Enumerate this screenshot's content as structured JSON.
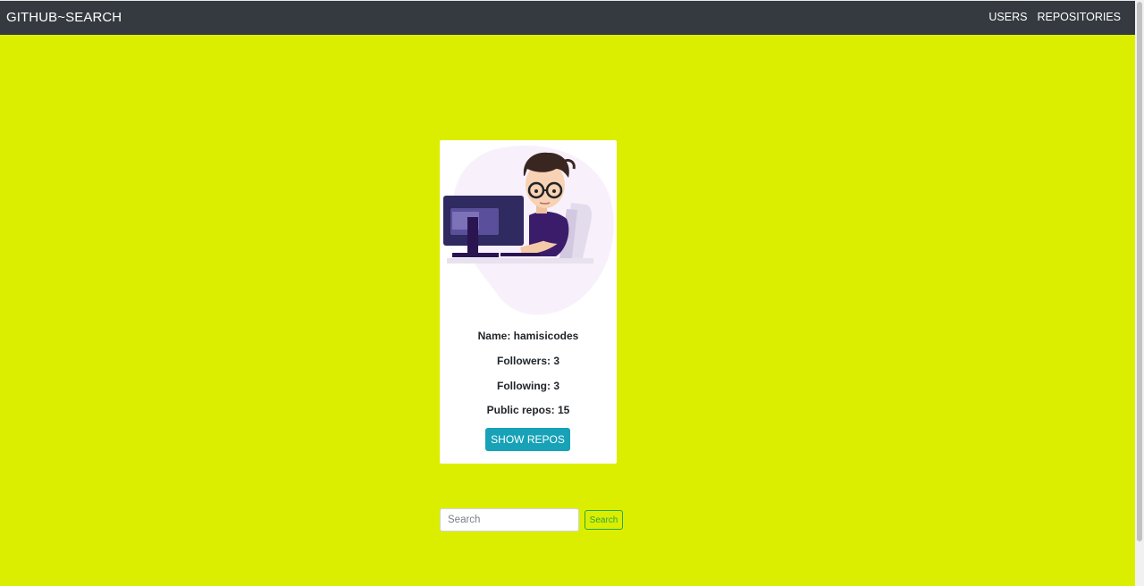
{
  "navbar": {
    "brand": "GITHUB~SEARCH",
    "links": [
      {
        "label": "USERS"
      },
      {
        "label": "REPOSITORIES"
      }
    ],
    "background": "#343a40"
  },
  "page": {
    "background": "#dcee00"
  },
  "profile": {
    "avatar_icon": "developer-illustration",
    "name_line": "Name: hamisicodes",
    "followers_line": "Followers: 3",
    "following_line": "Following: 3",
    "repos_line": "Public repos: 15",
    "show_repos_label": "SHOW REPOS",
    "button_color": "#17a2b8"
  },
  "search": {
    "placeholder": "Search",
    "value": "",
    "button_label": "Search",
    "button_color": "#28a745"
  }
}
